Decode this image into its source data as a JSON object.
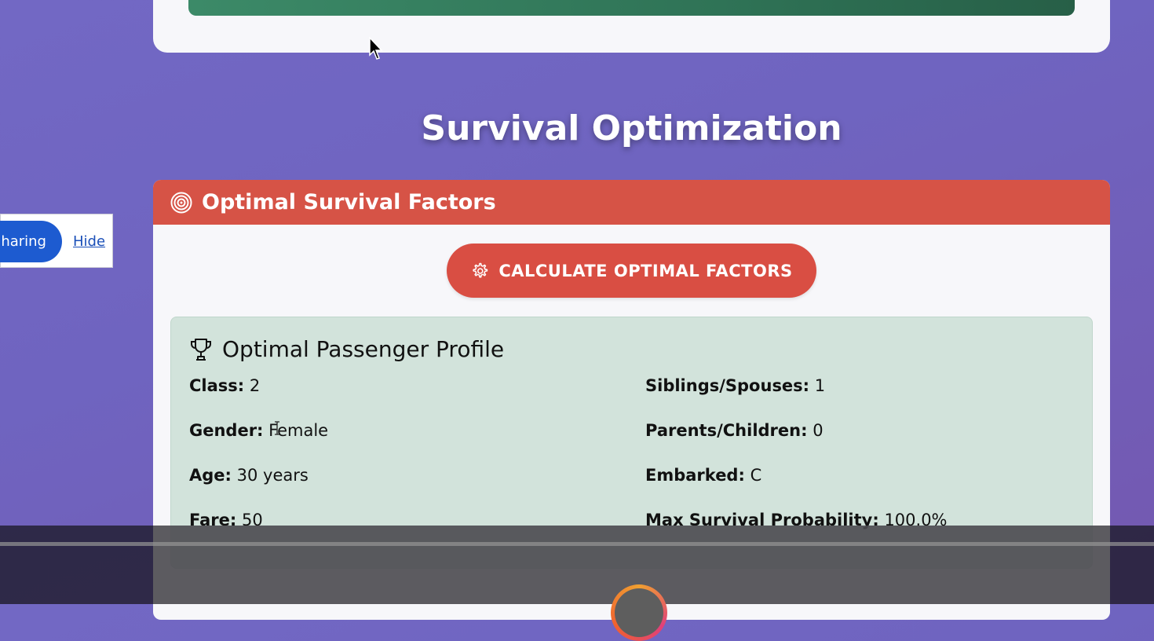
{
  "page": {
    "section_title": "Survival Optimization"
  },
  "optimal_card": {
    "header": "Optimal Survival Factors",
    "header_icon": "target-icon",
    "button_label": "CALCULATE OPTIMAL FACTORS",
    "button_icon": "gear-icon",
    "accent_color": "#d65346"
  },
  "profile": {
    "title": "Optimal Passenger Profile",
    "title_icon": "trophy-icon",
    "fields": [
      {
        "label": "Class:",
        "value": "2"
      },
      {
        "label": "Gender:",
        "value": "Female"
      },
      {
        "label": "Age:",
        "value": "30 years"
      },
      {
        "label": "Fare:",
        "value": "50"
      },
      {
        "label": "Siblings/Spouses:",
        "value": "1"
      },
      {
        "label": "Parents/Children:",
        "value": "0"
      },
      {
        "label": "Embarked:",
        "value": "C"
      },
      {
        "label": "Max Survival Probability:",
        "value": "100.0%"
      }
    ]
  },
  "share_panel": {
    "share_label": "haring",
    "hide_label": "Hide"
  }
}
